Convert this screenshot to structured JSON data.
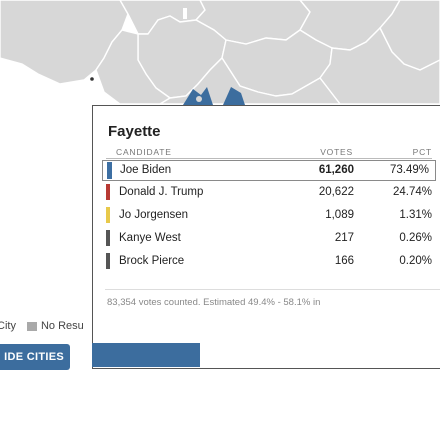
{
  "colors": {
    "accent": "#3c6d9e",
    "biden": "#3d6fa3",
    "trump": "#b83a34",
    "jorgensen": "#e8c94a",
    "west": "#555555",
    "pierce": "#555555",
    "no_results": "#a9a9a9"
  },
  "legend": {
    "city_label": "City",
    "no_results_label": "No Resu"
  },
  "cities_button": {
    "label": "IDE CITIES"
  },
  "popup": {
    "county": "Fayette",
    "headers": {
      "candidate": "CANDIDATE",
      "votes": "VOTES",
      "pct": "PCT"
    },
    "rows": [
      {
        "candidate": "Joe Biden",
        "votes": "61,260",
        "pct": "73.49%",
        "color": "#3d6fa3",
        "winner": true
      },
      {
        "candidate": "Donald J. Trump",
        "votes": "20,622",
        "pct": "24.74%",
        "color": "#b83a34",
        "winner": false
      },
      {
        "candidate": "Jo Jorgensen",
        "votes": "1,089",
        "pct": "1.31%",
        "color": "#e8c94a",
        "winner": false
      },
      {
        "candidate": "Kanye West",
        "votes": "217",
        "pct": "0.26%",
        "color": "#555555",
        "winner": false
      },
      {
        "candidate": "Brock Pierce",
        "votes": "166",
        "pct": "0.20%",
        "color": "#555555",
        "winner": false
      }
    ],
    "footnote": "83,354 votes counted. Estimated 49.4% - 58.1% in"
  },
  "icons": [
    "map-marker-icon",
    "map-marker-icon",
    "dot-marker-icon"
  ]
}
